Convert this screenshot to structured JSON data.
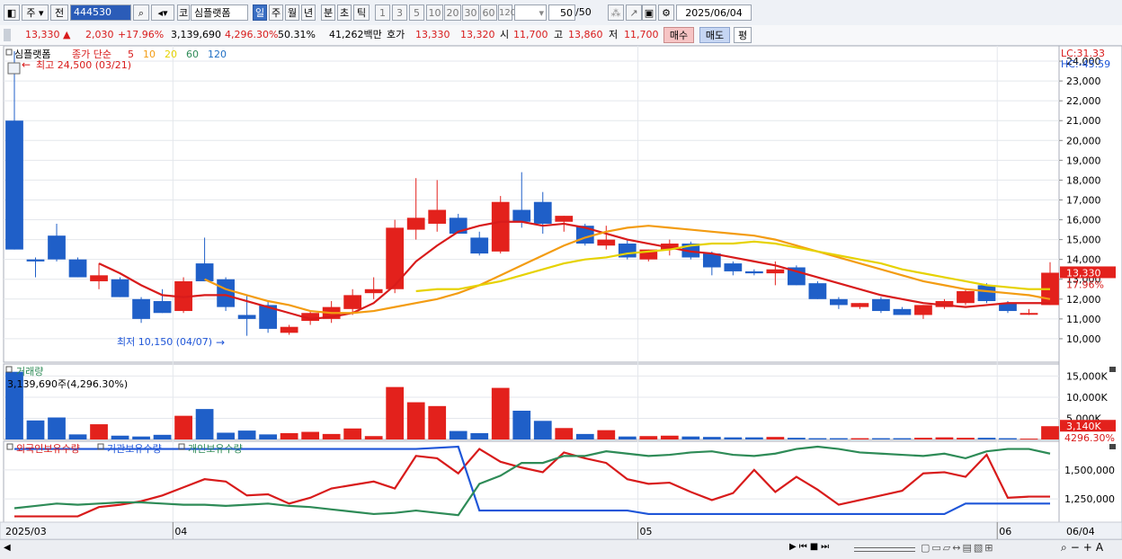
{
  "toolbar": {
    "period_left": "주",
    "prev_label": "전",
    "code": "444530",
    "market_tag": "코",
    "stock_name": "심플랫폼",
    "timeframes": [
      "일",
      "주",
      "월",
      "년",
      "분",
      "초",
      "틱"
    ],
    "minute_options": [
      "1",
      "3",
      "5",
      "10",
      "20",
      "30",
      "60",
      "120"
    ],
    "count": "50",
    "count_total": "/50",
    "date": "2025/06/04"
  },
  "quote": {
    "price": "13,330",
    "change": "2,030",
    "change_pct": "+17.96%",
    "volume": "3,139,690",
    "volume_pct": "4,296.30%",
    "turnover_pct": "50.31%",
    "amount": "41,262백만",
    "bid_label": "호가",
    "ask": "13,330",
    "bid": "13,320",
    "open_label": "시",
    "open": "11,700",
    "high_label": "고",
    "high": "13,860",
    "low_label": "저",
    "low": "11,700",
    "buy_label": "매수",
    "sell_label": "매도",
    "eval_label": "평"
  },
  "legend": {
    "name": "심플랫폼",
    "ma_label": "종가 단순",
    "ma_periods": [
      "5",
      "10",
      "20",
      "60",
      "120"
    ],
    "ma_colors": [
      "#d81b1b",
      "#f39c12",
      "#e6d200",
      "#2e8b57",
      "#1f6fc4"
    ]
  },
  "lc_label": "LC:31.33",
  "hc_label": "HC:-45.59",
  "max_annotation": "최고 24,500 (03/21)",
  "min_annotation": "최저 10,150 (04/07)",
  "last_price_tag": "13,330",
  "last_pct_tag": "17.96%",
  "volume_title": "거래량",
  "volume_info": "3,139,690주(4,296.30%)",
  "volume_tag": "3,140K",
  "volume_pct_tag": "4296.30%",
  "holdings_legend": [
    "외국인보유수량",
    "기관보유수량",
    "개인보유수량"
  ],
  "holdings_colors": [
    "#d81b1b",
    "#1f56d8",
    "#2e8b57"
  ],
  "x_axis_labels": [
    "2025/03",
    "04",
    "05",
    "06",
    "06/04"
  ],
  "colors": {
    "up": "#e3211c",
    "down": "#1f5fc8"
  },
  "chart_data": [
    {
      "type": "candlestick",
      "ylim": [
        9000,
        24500
      ],
      "yticks": [
        10000,
        11000,
        12000,
        13000,
        14000,
        15000,
        16000,
        17000,
        18000,
        19000,
        20000,
        21000,
        22000,
        23000,
        24000
      ],
      "candles": [
        {
          "o": 21000,
          "h": 24500,
          "l": 14500,
          "c": 14500
        },
        {
          "o": 14000,
          "h": 14100,
          "l": 13100,
          "c": 13900
        },
        {
          "o": 15200,
          "h": 15800,
          "l": 13900,
          "c": 14000
        },
        {
          "o": 14000,
          "h": 14100,
          "l": 13100,
          "c": 13100
        },
        {
          "o": 12900,
          "h": 13800,
          "l": 12500,
          "c": 13200
        },
        {
          "o": 13000,
          "h": 13100,
          "l": 12100,
          "c": 12100
        },
        {
          "o": 12000,
          "h": 12100,
          "l": 10800,
          "c": 11000
        },
        {
          "o": 11900,
          "h": 12500,
          "l": 11300,
          "c": 11300
        },
        {
          "o": 11400,
          "h": 13100,
          "l": 11300,
          "c": 12900
        },
        {
          "o": 13800,
          "h": 15100,
          "l": 12900,
          "c": 12900
        },
        {
          "o": 13000,
          "h": 13100,
          "l": 11400,
          "c": 11600
        },
        {
          "o": 11200,
          "h": 12200,
          "l": 10150,
          "c": 11000
        },
        {
          "o": 11700,
          "h": 11900,
          "l": 10300,
          "c": 10500
        },
        {
          "o": 10300,
          "h": 10700,
          "l": 10200,
          "c": 10600
        },
        {
          "o": 10900,
          "h": 11400,
          "l": 10700,
          "c": 11300
        },
        {
          "o": 11000,
          "h": 11900,
          "l": 10800,
          "c": 11600
        },
        {
          "o": 11500,
          "h": 12500,
          "l": 11200,
          "c": 12200
        },
        {
          "o": 12300,
          "h": 13100,
          "l": 12000,
          "c": 12500
        },
        {
          "o": 12500,
          "h": 16000,
          "l": 12300,
          "c": 15600
        },
        {
          "o": 15500,
          "h": 18100,
          "l": 15000,
          "c": 16100
        },
        {
          "o": 15800,
          "h": 18000,
          "l": 15400,
          "c": 16500
        },
        {
          "o": 16100,
          "h": 16300,
          "l": 15300,
          "c": 15300
        },
        {
          "o": 15100,
          "h": 15400,
          "l": 14200,
          "c": 14300
        },
        {
          "o": 14400,
          "h": 17200,
          "l": 14300,
          "c": 16900
        },
        {
          "o": 16500,
          "h": 18400,
          "l": 15600,
          "c": 15900
        },
        {
          "o": 16900,
          "h": 17400,
          "l": 15300,
          "c": 15800
        },
        {
          "o": 15900,
          "h": 16200,
          "l": 15400,
          "c": 16200
        },
        {
          "o": 15700,
          "h": 15800,
          "l": 14700,
          "c": 14800
        },
        {
          "o": 14700,
          "h": 15700,
          "l": 14500,
          "c": 15000
        },
        {
          "o": 14800,
          "h": 15000,
          "l": 14000,
          "c": 14100
        },
        {
          "o": 14000,
          "h": 14500,
          "l": 13900,
          "c": 14500
        },
        {
          "o": 14500,
          "h": 15000,
          "l": 14200,
          "c": 14800
        },
        {
          "o": 14800,
          "h": 14900,
          "l": 14000,
          "c": 14100
        },
        {
          "o": 14300,
          "h": 14400,
          "l": 13200,
          "c": 13600
        },
        {
          "o": 13800,
          "h": 13900,
          "l": 13200,
          "c": 13400
        },
        {
          "o": 13400,
          "h": 13500,
          "l": 13200,
          "c": 13300
        },
        {
          "o": 13300,
          "h": 13900,
          "l": 12700,
          "c": 13500
        },
        {
          "o": 13600,
          "h": 13700,
          "l": 12700,
          "c": 12700
        },
        {
          "o": 12800,
          "h": 12900,
          "l": 12000,
          "c": 12000
        },
        {
          "o": 12000,
          "h": 12100,
          "l": 11500,
          "c": 11700
        },
        {
          "o": 11600,
          "h": 11800,
          "l": 11500,
          "c": 11800
        },
        {
          "o": 12000,
          "h": 12100,
          "l": 11300,
          "c": 11400
        },
        {
          "o": 11500,
          "h": 11600,
          "l": 11200,
          "c": 11200
        },
        {
          "o": 11200,
          "h": 11700,
          "l": 11000,
          "c": 11700
        },
        {
          "o": 11600,
          "h": 12000,
          "l": 11500,
          "c": 11900
        },
        {
          "o": 11800,
          "h": 12500,
          "l": 11700,
          "c": 12400
        },
        {
          "o": 12700,
          "h": 12800,
          "l": 11800,
          "c": 11900
        },
        {
          "o": 11800,
          "h": 11900,
          "l": 11300,
          "c": 11400
        },
        {
          "o": 11300,
          "h": 11500,
          "l": 11200,
          "c": 11300
        },
        {
          "o": 11700,
          "h": 13860,
          "l": 11700,
          "c": 13330
        }
      ],
      "ma": [
        {
          "name": "5",
          "color": "#d81b1b",
          "start": 4,
          "values": [
            13800,
            13300,
            12700,
            12200,
            12100,
            12200,
            12200,
            11900,
            11600,
            11300,
            11000,
            11100,
            11300,
            11800,
            12700,
            13900,
            14700,
            15400,
            15700,
            15900,
            15900,
            15700,
            15800,
            15600,
            15300,
            15000,
            14800,
            14600,
            14400,
            14300,
            14100,
            13900,
            13700,
            13400,
            13100,
            12800,
            12500,
            12200,
            12000,
            11800,
            11700,
            11600,
            11700,
            11800,
            11800,
            11800
          ]
        },
        {
          "name": "10",
          "color": "#f39c12",
          "start": 9,
          "values": [
            13000,
            12500,
            12200,
            11900,
            11700,
            11400,
            11300,
            11300,
            11400,
            11600,
            11800,
            12000,
            12300,
            12700,
            13200,
            13700,
            14200,
            14700,
            15100,
            15400,
            15600,
            15700,
            15600,
            15500,
            15400,
            15300,
            15200,
            15000,
            14700,
            14400,
            14100,
            13800,
            13500,
            13200,
            12900,
            12700,
            12500,
            12400,
            12300,
            12200,
            12000
          ]
        },
        {
          "name": "20",
          "color": "#e6d200",
          "start": 19,
          "values": [
            12400,
            12500,
            12500,
            12700,
            12900,
            13200,
            13500,
            13800,
            14000,
            14100,
            14300,
            14400,
            14500,
            14700,
            14800,
            14800,
            14900,
            14800,
            14600,
            14400,
            14200,
            14000,
            13800,
            13500,
            13300,
            13100,
            12900,
            12700,
            12600,
            12500,
            12500
          ]
        }
      ]
    },
    {
      "type": "bar",
      "title": "거래량",
      "yticks": [
        5000000,
        10000000,
        15000000
      ],
      "ytick_labels": [
        "5,000K",
        "10,000K",
        "15,000K"
      ],
      "ylim": [
        0,
        17000000
      ],
      "values": [
        16000000,
        4500000,
        5200000,
        1200000,
        3600000,
        900000,
        700000,
        1100000,
        5600000,
        7200000,
        1600000,
        2100000,
        1200000,
        1500000,
        1800000,
        1300000,
        2600000,
        800000,
        12400000,
        8800000,
        7900000,
        2000000,
        1500000,
        12200000,
        6800000,
        4400000,
        2700000,
        1300000,
        2200000,
        700000,
        800000,
        900000,
        700000,
        600000,
        500000,
        500000,
        600000,
        400000,
        300000,
        300000,
        300000,
        300000,
        300000,
        400000,
        500000,
        400000,
        400000,
        300000,
        200000,
        3140000
      ]
    },
    {
      "type": "line",
      "ylim": [
        1050000,
        1700000
      ],
      "yticks": [
        1250000,
        1500000
      ],
      "ytick_labels": [
        "1,250,000",
        "1,500,000"
      ],
      "series": [
        {
          "name": "외국인보유수량",
          "color": "#d81b1b",
          "values": [
            1100000,
            1100000,
            1100000,
            1100000,
            1180000,
            1200000,
            1230000,
            1280000,
            1350000,
            1420000,
            1400000,
            1280000,
            1290000,
            1210000,
            1260000,
            1340000,
            1370000,
            1400000,
            1340000,
            1620000,
            1600000,
            1470000,
            1680000,
            1570000,
            1520000,
            1480000,
            1650000,
            1600000,
            1560000,
            1420000,
            1380000,
            1390000,
            1310000,
            1240000,
            1300000,
            1500000,
            1310000,
            1440000,
            1330000,
            1200000,
            1240000,
            1280000,
            1320000,
            1470000,
            1480000,
            1440000,
            1630000,
            1260000,
            1270000,
            1270000
          ]
        },
        {
          "name": "기관보유수량",
          "color": "#1f56d8",
          "values": [
            1680000,
            1680000,
            1680000,
            1680000,
            1680000,
            1680000,
            1680000,
            1680000,
            1680000,
            1680000,
            1680000,
            1680000,
            1680000,
            1680000,
            1680000,
            1680000,
            1680000,
            1680000,
            1680000,
            1680000,
            1690000,
            1700000,
            1150000,
            1150000,
            1150000,
            1150000,
            1150000,
            1150000,
            1150000,
            1150000,
            1120000,
            1120000,
            1120000,
            1120000,
            1120000,
            1120000,
            1120000,
            1120000,
            1120000,
            1120000,
            1120000,
            1120000,
            1120000,
            1120000,
            1120000,
            1210000,
            1210000,
            1210000,
            1210000,
            1210000
          ]
        },
        {
          "name": "개인보유수량",
          "color": "#2e8b57",
          "values": [
            1170000,
            1190000,
            1210000,
            1200000,
            1210000,
            1220000,
            1220000,
            1210000,
            1200000,
            1200000,
            1190000,
            1200000,
            1210000,
            1190000,
            1180000,
            1160000,
            1140000,
            1120000,
            1130000,
            1150000,
            1130000,
            1110000,
            1380000,
            1450000,
            1560000,
            1560000,
            1620000,
            1620000,
            1660000,
            1640000,
            1620000,
            1630000,
            1650000,
            1660000,
            1630000,
            1620000,
            1640000,
            1680000,
            1700000,
            1680000,
            1650000,
            1640000,
            1630000,
            1620000,
            1640000,
            1600000,
            1660000,
            1680000,
            1680000,
            1640000
          ]
        }
      ]
    }
  ]
}
